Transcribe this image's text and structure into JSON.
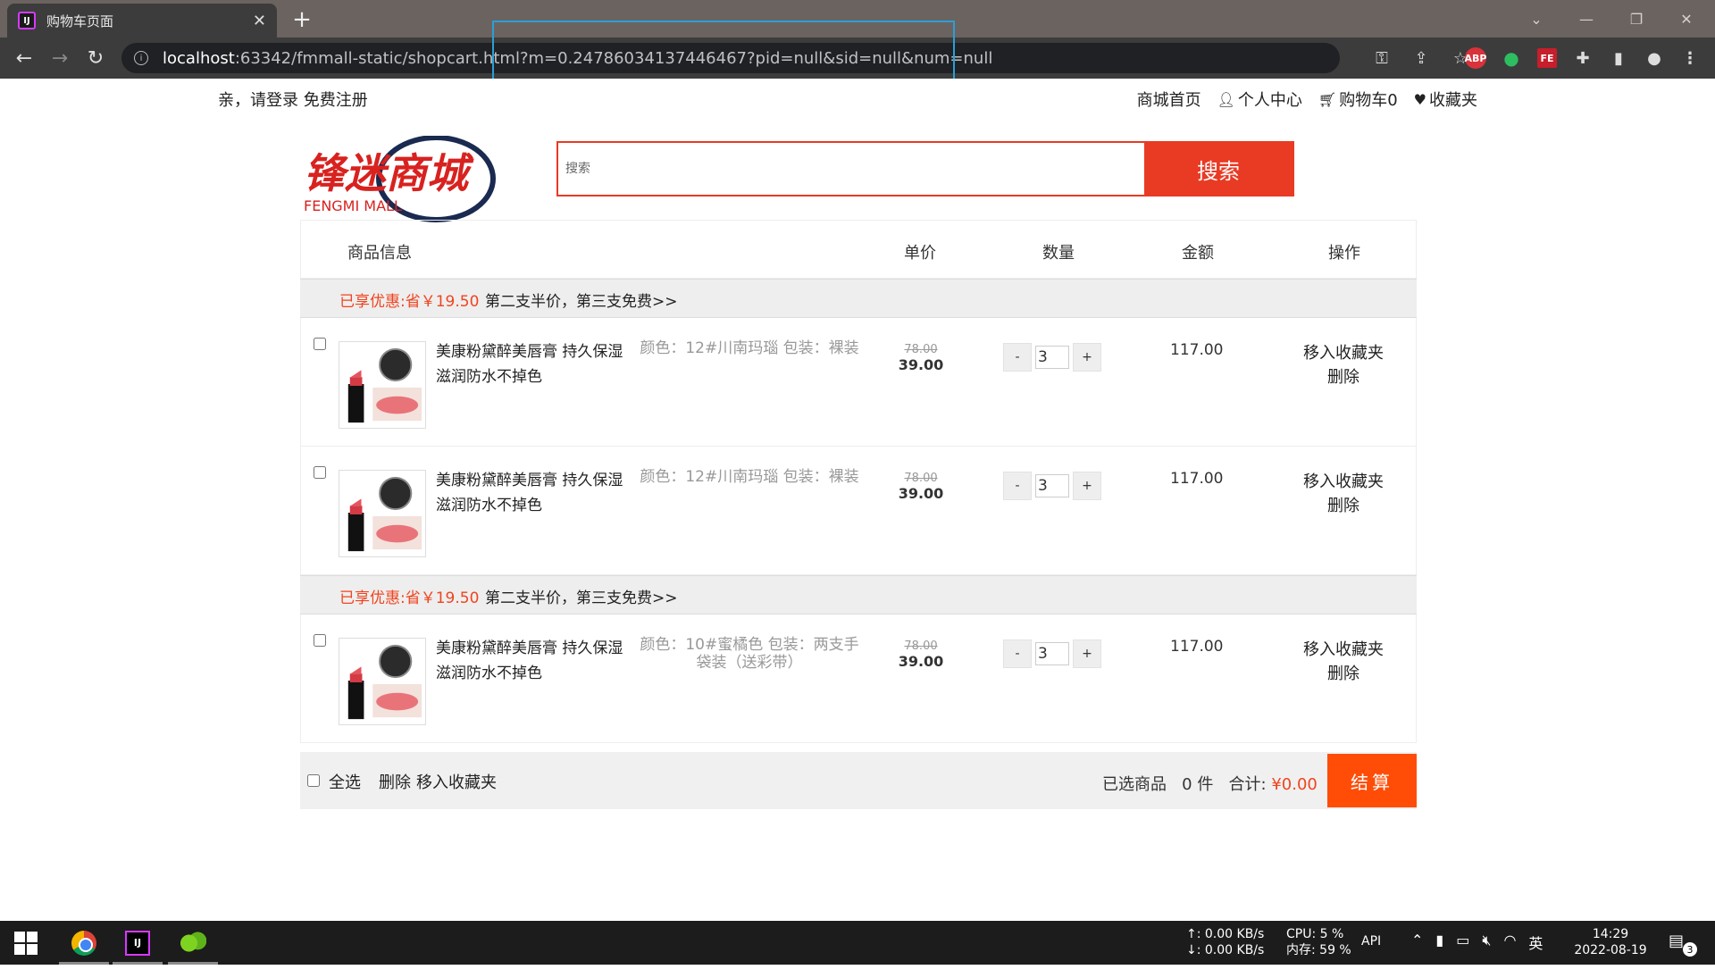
{
  "browser": {
    "tab_title": "购物车页面",
    "tab_favicon": "IJ",
    "url_host": "localhost",
    "url_rest": ":63342/fmmall-static/shopcart.html?m=0.24786034137446467?pid=null&sid=null&num=null"
  },
  "topnav": {
    "login_text": "亲，请登录 免费注册",
    "links": [
      {
        "label": "商城首页",
        "icon": ""
      },
      {
        "label": "个人中心",
        "icon": "user-icon"
      },
      {
        "label": "购物车0",
        "icon": "cart-icon"
      },
      {
        "label": "收藏夹",
        "icon": "heart-icon"
      }
    ]
  },
  "logo": {
    "cn": "锋迷商城",
    "en": "FENGMI MALL"
  },
  "search": {
    "placeholder": "搜索",
    "button": "搜索"
  },
  "cart": {
    "headers": [
      "商品信息",
      "单价",
      "数量",
      "金额",
      "操作"
    ],
    "groups": [
      {
        "promo_save": "已享优惠:省￥19.50",
        "promo_rule": "第二支半价，第三支免费>>",
        "items": [
          {
            "name": "美康粉黛醉美唇膏 持久保湿滋润防水不掉色",
            "attrs": "颜色：12#川南玛瑙 包装：裸装",
            "old_price": "78.00",
            "price": "39.00",
            "qty": "3",
            "amount": "117.00",
            "op1": "移入收藏夹",
            "op2": "删除"
          },
          {
            "name": "美康粉黛醉美唇膏 持久保湿滋润防水不掉色",
            "attrs": "颜色：12#川南玛瑙 包装：裸装",
            "old_price": "78.00",
            "price": "39.00",
            "qty": "3",
            "amount": "117.00",
            "op1": "移入收藏夹",
            "op2": "删除"
          }
        ]
      },
      {
        "promo_save": "已享优惠:省￥19.50",
        "promo_rule": "第二支半价，第三支免费>>",
        "items": [
          {
            "name": "美康粉黛醉美唇膏 持久保湿滋润防水不掉色",
            "attrs": "颜色：10#蜜橘色 包装：两支手袋装（送彩带）",
            "old_price": "78.00",
            "price": "39.00",
            "qty": "3",
            "amount": "117.00",
            "op1": "移入收藏夹",
            "op2": "删除"
          }
        ]
      }
    ],
    "qty_minus": "-",
    "qty_plus": "+",
    "footer": {
      "select_all": "全选",
      "delete": "删除",
      "move_fav": "移入收藏夹",
      "selected_label": "已选商品",
      "selected_count": "0",
      "selected_unit": "件",
      "total_label": "合计:",
      "total_value": "¥0.00",
      "checkout": "结算"
    }
  },
  "taskbar": {
    "net_up": "↑: 0.00 KB/s",
    "net_down": "↓: 0.00 KB/s",
    "cpu": "CPU: 5 %",
    "mem": "内存: 59 %",
    "api": "API",
    "ime": "英",
    "time": "14:29",
    "date": "2022-08-19",
    "notifications": "3"
  },
  "colors": {
    "accent_red": "#e93a24",
    "promo_orange": "#f0441f",
    "checkout_orange": "#ff4d08"
  }
}
